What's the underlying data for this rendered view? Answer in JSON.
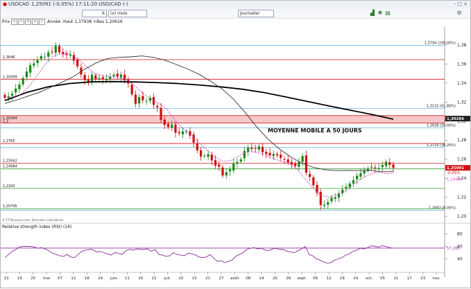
{
  "window": {
    "title": "USDCAD",
    "quote": "1,25091 (-0,05%) 17:11:20 USD/CAD (-)",
    "controls": "- □ ×"
  },
  "toolbar": {
    "period_value": "6",
    "period_unit": "(x) mois",
    "interval": "Journalier"
  },
  "header": {
    "label": "Prix",
    "summary": "Année :Haut 1,37938 +Bas 1,20616"
  },
  "colors": {
    "up": "#1a8a1a",
    "down": "#d01010",
    "sma50": "#333333",
    "sma200": "#000000",
    "ema": "#d04ad0",
    "rsi": "#8b2a9c",
    "level": "#d01010",
    "fib": "#66b3e0",
    "green_level": "#2e9b2e"
  },
  "chart_data": [
    {
      "type": "candlestick",
      "title": "",
      "annotation": "MOYENNE MOBILE A 50 JOURS",
      "ylim": [
        1.195,
        1.393
      ],
      "yticks": [
        "1,38",
        "1,36",
        "1,34",
        "1,32",
        "1,30",
        "1,28",
        "1,26",
        "1,24",
        "1,22",
        "1,20"
      ],
      "ytick_values": [
        1.38,
        1.36,
        1.34,
        1.32,
        1.3,
        1.28,
        1.26,
        1.24,
        1.22,
        1.2
      ],
      "xticks": [
        "13",
        "19",
        "25",
        "mai",
        "07",
        "12",
        "18",
        "24",
        "juin",
        "11",
        "16",
        "22",
        "juil.",
        "10",
        "15",
        "21",
        "27",
        "août",
        "08",
        "14",
        "20",
        "26",
        "sept.",
        "06",
        "12",
        "18",
        "24",
        "oct.",
        "05",
        "11",
        "17",
        "23",
        "nov."
      ],
      "horizontal_levels": [
        {
          "value": 1.3646,
          "label": "1,3646",
          "kind": "red"
        },
        {
          "value": 1.34399,
          "label": "1,34399",
          "kind": "red"
        },
        {
          "value": 1.30394,
          "label": "1,30394",
          "kind": "red"
        },
        {
          "value": 1.2765,
          "label": "1,2765",
          "kind": "red"
        },
        {
          "value": 1.25562,
          "label": "1,25562",
          "kind": "red"
        },
        {
          "value": 1.24984,
          "label": "1,24984",
          "kind": "green"
        },
        {
          "value": 1.2293,
          "label": "1,2293",
          "kind": "green"
        },
        {
          "value": 1.20795,
          "label": "1,20795",
          "kind": "green"
        }
      ],
      "band": {
        "from": 1.298,
        "to": 1.3058,
        "label_top": "1,30394",
        "label_bottom": "1,3"
      },
      "fibonacci": [
        {
          "value": 1.3794,
          "label": "1,3794 (100,00%)"
        },
        {
          "value": 1.3132,
          "label": "1,3132 (61,80%)"
        },
        {
          "value": 1.2928,
          "label": "1,2928 (50,00%)"
        },
        {
          "value": 1.2723,
          "label": "1,2723 (38,20%)"
        },
        {
          "value": 1.2062,
          "label": "1,2062 (0,00%)"
        }
      ],
      "last_price": {
        "value": 1.25091,
        "label": "1,25091",
        "change": "-0,05%",
        "ema_value": 1.24486,
        "ema_label": "1,24486"
      },
      "sma200_label": {
        "value": 1.30266,
        "label": "1,30266"
      },
      "closes": [
        1.3245,
        1.3262,
        1.3288,
        1.3343,
        1.3385,
        1.3452,
        1.3521,
        1.3587,
        1.3606,
        1.3641,
        1.3683,
        1.3676,
        1.3722,
        1.3728,
        1.3793,
        1.3723,
        1.3702,
        1.3695,
        1.3695,
        1.3636,
        1.3575,
        1.3489,
        1.343,
        1.3404,
        1.3488,
        1.3442,
        1.3452,
        1.3439,
        1.3445,
        1.3469,
        1.3487,
        1.3468,
        1.3489,
        1.3427,
        1.3395,
        1.3282,
        1.3182,
        1.3252,
        1.3219,
        1.3213,
        1.3245,
        1.3171,
        1.3143,
        1.3011,
        1.2959,
        1.2937,
        1.2965,
        1.2878,
        1.2873,
        1.2893,
        1.289,
        1.2848,
        1.2774,
        1.2693,
        1.2628,
        1.2637,
        1.2653,
        1.2587,
        1.2532,
        1.2521,
        1.2429,
        1.2464,
        1.2493,
        1.2557,
        1.2571,
        1.2598,
        1.2687,
        1.2721,
        1.2707,
        1.2711,
        1.2734,
        1.2673,
        1.2655,
        1.264,
        1.2654,
        1.264,
        1.2614,
        1.2601,
        1.2567,
        1.2544,
        1.2528,
        1.2571,
        1.2633,
        1.2458,
        1.2413,
        1.2326,
        1.2245,
        1.2119,
        1.2121,
        1.2149,
        1.2196,
        1.2201,
        1.2238,
        1.228,
        1.2311,
        1.2345,
        1.238,
        1.2427,
        1.2454,
        1.2479,
        1.2501,
        1.2522,
        1.2505,
        1.2508,
        1.254,
        1.2573,
        1.2541,
        1.2509
      ],
      "sma50": [
        1.3185,
        1.322,
        1.3262,
        1.3302,
        1.3355,
        1.3408,
        1.3468,
        1.3546,
        1.3612,
        1.3658,
        1.367,
        1.3675,
        1.3685,
        1.367,
        1.364,
        1.3595,
        1.3548,
        1.3492,
        1.342,
        1.334,
        1.3232,
        1.3095,
        1.2945,
        1.2815,
        1.271,
        1.2625,
        1.2558,
        1.2515,
        1.249,
        1.248,
        1.2482,
        1.248,
        1.2482,
        1.2468,
        1.247
      ],
      "sma200": [
        1.3215,
        1.33,
        1.336,
        1.3395,
        1.3412,
        1.3415,
        1.3412,
        1.3405,
        1.3395,
        1.338,
        1.336,
        1.3335,
        1.33,
        1.3255,
        1.3208,
        1.316,
        1.3115,
        1.307,
        1.302
      ],
      "ema": [
        1.3245,
        1.3255,
        1.3281,
        1.3366,
        1.3478,
        1.3597,
        1.368,
        1.3713,
        1.3705,
        1.3658,
        1.358,
        1.3505,
        1.3475,
        1.3468,
        1.346,
        1.344,
        1.3371,
        1.3296,
        1.3238,
        1.319,
        1.3126,
        1.3012,
        1.2923,
        1.2856,
        1.2773,
        1.2692,
        1.2621,
        1.2575,
        1.2588,
        1.2638,
        1.268,
        1.2676,
        1.265,
        1.2615,
        1.258,
        1.2565,
        1.2508,
        1.2402,
        1.2302,
        1.2226,
        1.2201,
        1.2223,
        1.2266,
        1.233,
        1.2392,
        1.2437,
        1.2464,
        1.2451,
        1.2449
      ]
    },
    {
      "type": "line",
      "title": "Relative strength index (RSI) (14)",
      "ylim": [
        25,
        85
      ],
      "yticks": [
        "80",
        "60",
        "40"
      ],
      "ytick_values": [
        80,
        60,
        40
      ],
      "reference_level": 57.265,
      "last_label": "57,265",
      "values": [
        42,
        47,
        52,
        55,
        59,
        60,
        60,
        60,
        59,
        57,
        58,
        56,
        53,
        49,
        47,
        45,
        44,
        47,
        43,
        42,
        47,
        52,
        54,
        55,
        55,
        51,
        52,
        50,
        48,
        46,
        50,
        49,
        47,
        53,
        55,
        54,
        56,
        55,
        55,
        56,
        52,
        55,
        47,
        46,
        44,
        45,
        50,
        47,
        46,
        45,
        49,
        48,
        46,
        43,
        42,
        43,
        47,
        41,
        36,
        37,
        34,
        36,
        38,
        44,
        47,
        50,
        55,
        57,
        58,
        56,
        57,
        54,
        53,
        56,
        57,
        55,
        55,
        52,
        51,
        50,
        53,
        56,
        60,
        47,
        45,
        40,
        38,
        35,
        33,
        34,
        38,
        40,
        42,
        46,
        48,
        52,
        54,
        57,
        56,
        58,
        61,
        60,
        59,
        61,
        60,
        58,
        57
      ]
    }
  ],
  "footer": {
    "credit": "© FT-finance.com, Données indicatives"
  }
}
